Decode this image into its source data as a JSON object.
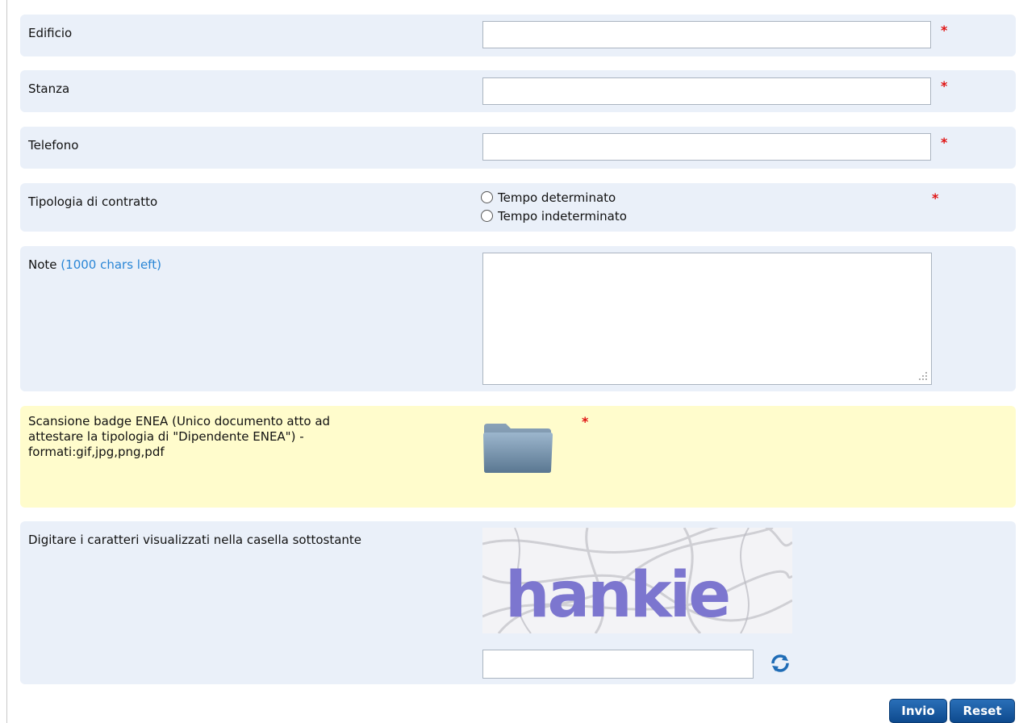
{
  "form": {
    "edificio": {
      "label": "Edificio",
      "value": "",
      "required_mark": "*"
    },
    "stanza": {
      "label": "Stanza",
      "value": "",
      "required_mark": "*"
    },
    "telefono": {
      "label": "Telefono",
      "value": "",
      "required_mark": "*"
    },
    "contratto": {
      "label": "Tipologia di contratto",
      "required_mark": "*",
      "options": [
        "Tempo determinato",
        "Tempo indeterminato"
      ],
      "selected": null
    },
    "note": {
      "label": "Note",
      "chars_left": "(1000 chars left)",
      "value": ""
    },
    "badge": {
      "label_lines": [
        "Scansione badge ENEA (Unico documento atto ad",
        "attestare la tipologia di \"Dipendente ENEA\") -",
        "formati:gif,jpg,png,pdf"
      ],
      "required_mark": "*",
      "icon": "folder-icon"
    },
    "captcha": {
      "label": "Digitare i caratteri visualizzati nella casella sottostante",
      "image_text": "hankie",
      "value": "",
      "refresh_icon": "refresh-icon"
    }
  },
  "buttons": {
    "submit": "Invio",
    "reset": "Reset"
  },
  "colors": {
    "row_bg": "#eaf0f9",
    "highlight_bg": "#fffccc",
    "required": "#e01212",
    "link": "#2a86d6",
    "button": "#0e4a8e"
  }
}
